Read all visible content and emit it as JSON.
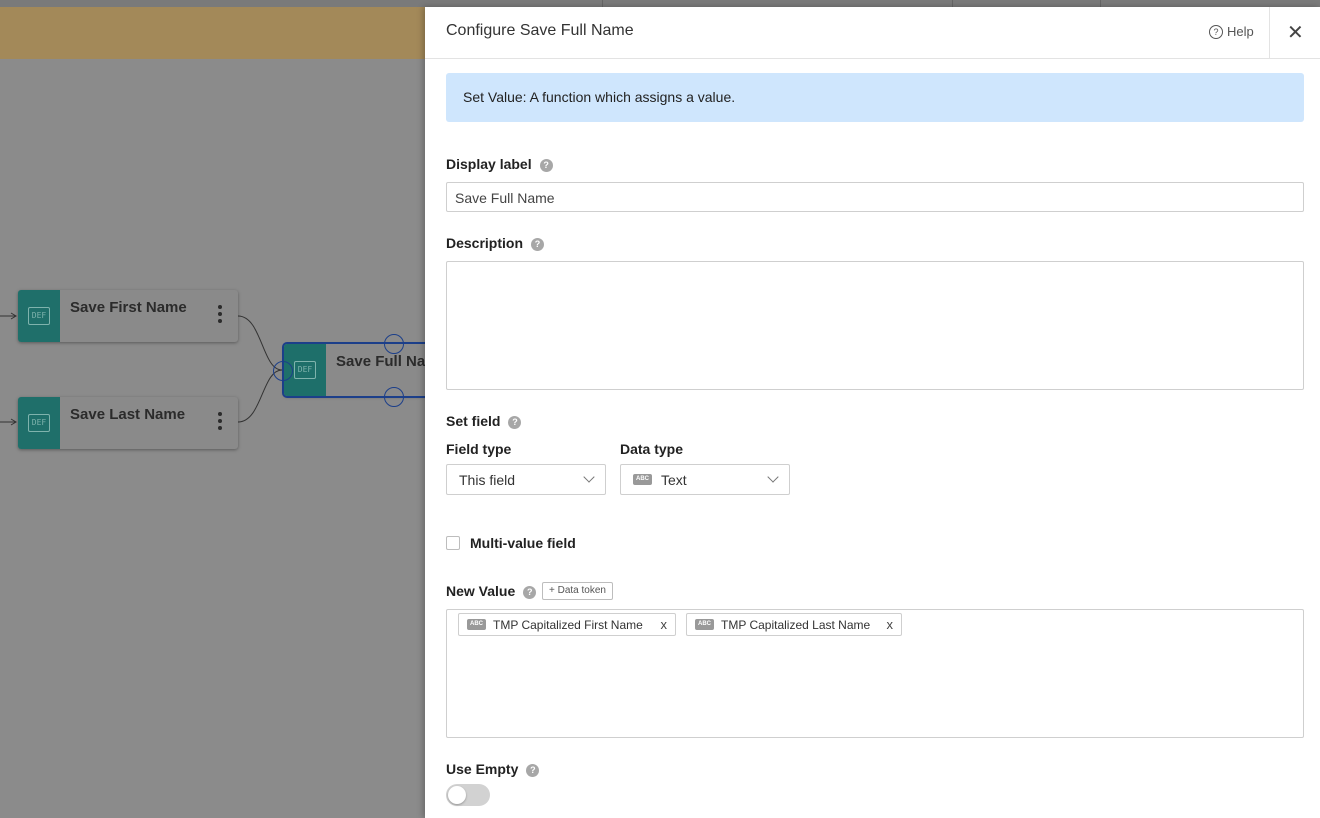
{
  "canvas": {
    "nodes": [
      {
        "title": "Save First Name",
        "icon": "def-icon"
      },
      {
        "title": "Save Last Name",
        "icon": "def-icon"
      },
      {
        "title": "Save Full Nam",
        "icon": "def-icon"
      }
    ],
    "def_label": "DEF"
  },
  "panel": {
    "title": "Configure Save Full Name",
    "help_label": "Help",
    "close_glyph": "✕",
    "info_text": "Set Value: A function which assigns a value.",
    "display_label": {
      "label": "Display label",
      "value": "Save Full Name"
    },
    "description": {
      "label": "Description",
      "value": ""
    },
    "set_field": {
      "label": "Set field",
      "field_type": {
        "label": "Field type",
        "value": "This field"
      },
      "data_type": {
        "label": "Data type",
        "value": "Text",
        "badge": "ABC"
      }
    },
    "multi_value": {
      "label": "Multi-value field",
      "checked": false
    },
    "new_value": {
      "label": "New Value",
      "data_token_button": "+ Data token",
      "tokens": [
        {
          "badge": "ABC",
          "label": "TMP Capitalized First Name",
          "remove": "x"
        },
        {
          "badge": "ABC",
          "label": "TMP Capitalized Last Name",
          "remove": "x"
        }
      ]
    },
    "use_empty": {
      "label": "Use Empty",
      "on": false
    },
    "help_mark": "?"
  },
  "colors": {
    "banner": "#a38959",
    "info_bg": "#cfe6fd",
    "node_def": "#1f6f6a",
    "selection": "#1c3f8a"
  }
}
